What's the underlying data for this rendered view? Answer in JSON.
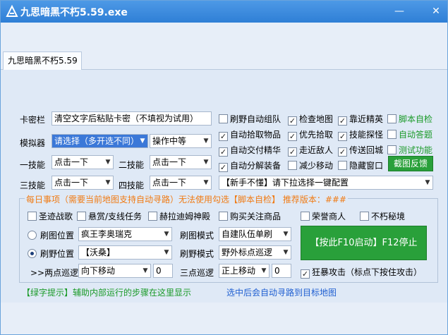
{
  "window": {
    "title": "九思暗黑不朽5.59.exe",
    "minimize_glyph": "—",
    "close_glyph": "✕"
  },
  "tab": {
    "label": "九思暗黑不朽5.59"
  },
  "form": {
    "card_label": "卡密栏",
    "card_value": "清空文字后粘贴卡密（不填视为试用）",
    "emulator_label": "模拟器",
    "emulator_value": "请选择（多开选不同）",
    "perf_value": "操作中等",
    "skill1_label": "一技能",
    "skill1_value": "点击一下",
    "skill2_label": "二技能",
    "skill2_value": "点击一下",
    "skill3_label": "三技能",
    "skill3_value": "点击一下",
    "skill4_label": "四技能",
    "skill4_value": "点击一下",
    "script_select": "【新手不懂】请下拉选择一键配置"
  },
  "checks": {
    "auto_team": "刷野自动组队",
    "check_map": "检查地图",
    "near_elite": "靠近精英",
    "script_check": "脚本自检",
    "auto_pick": "自动拾取物品",
    "priority_pick": "优先拾取",
    "skill_probe": "技能探怪",
    "auto_answer": "自动答题",
    "auto_submit": "自动交付精华",
    "walk_enemy": "走近敌人",
    "teleport_back": "传送回城",
    "test_func": "测试功能",
    "auto_decompose": "自动分解装备",
    "less_move": "减少移动",
    "hide_window": "隐藏窗口",
    "screenshot_btn": "截图反馈"
  },
  "daily": {
    "group_title": "每日事项（需要当前地图支持自动寻路）无法使用勾选【脚本自检】 推荐版本：###",
    "holy_song": "圣迹战歌",
    "bounty": "悬赏/支线任务",
    "hela_temple": "赫拉迪姆神殿",
    "buy_items": "购买关注商品",
    "honor_merchant": "荣誉商人",
    "immortal_realm": "不朽秘境",
    "map_pos_label": "刷图位置",
    "map_pos_value": "疯王李奥瑞克",
    "map_mode_label": "刷图模式",
    "map_mode_value": "自建队伍单刷",
    "wild_pos_label": "刷野位置",
    "wild_pos_value": "【沃桑】",
    "wild_mode_label": "刷野模式",
    "wild_mode_value": "野外标点巡逻",
    "start_button": "【按此F10启动】F12停止",
    "patrol2_label": ">>两点巡逻",
    "patrol2_value": "向下移动",
    "patrol2_num": "0",
    "patrol3_label": "三点巡逻",
    "patrol3_value": "正上移动",
    "patrol3_num": "0",
    "berserk": "狂暴攻击（标点下按住攻击）"
  },
  "footer": {
    "tip": "【绿字提示】辅助内部运行的步骤在这里显示",
    "hint": "选中后会自动寻路到目标地图"
  },
  "colors": {
    "titlebar": "#3a88dc",
    "accent_orange": "#f07b14",
    "accent_green": "#1a9a28",
    "link_blue": "#1f5fd1",
    "button_green": "#29a03a"
  }
}
